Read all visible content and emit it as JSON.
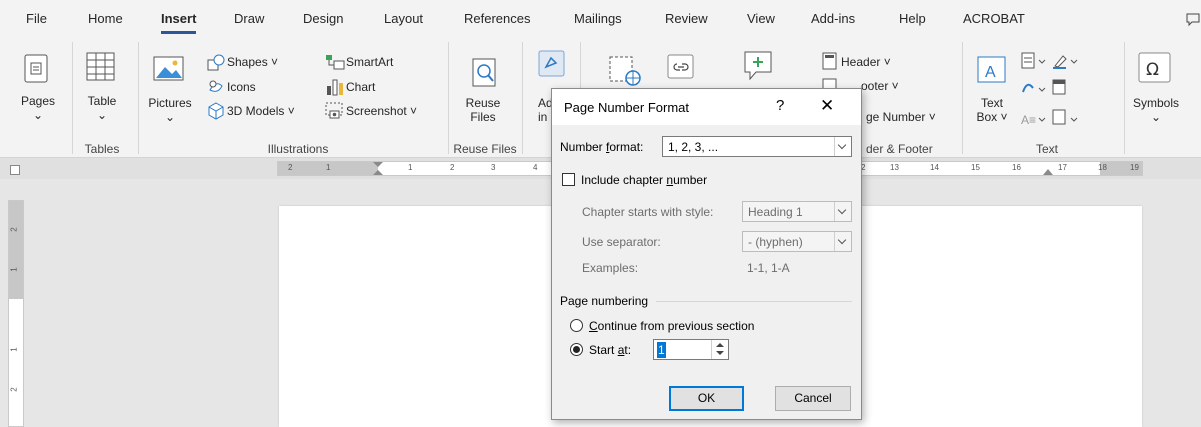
{
  "menu": {
    "tabs": [
      "File",
      "Home",
      "Insert",
      "Draw",
      "Design",
      "Layout",
      "References",
      "Mailings",
      "Review",
      "View",
      "Add-ins",
      "Help",
      "ACROBAT"
    ],
    "active": "Insert"
  },
  "ribbon": {
    "pages": {
      "label": "Pages",
      "arrow": "⌄"
    },
    "table": {
      "label": "Table",
      "arrow": "⌄"
    },
    "pictures": {
      "label": "Pictures",
      "arrow": "⌄"
    },
    "shapes": "Shapes ˅",
    "icons": "Icons",
    "models": "3D Models ˅",
    "smartart": "SmartArt",
    "chart": "Chart",
    "screenshot": "Screenshot ˅",
    "reuse_files": {
      "line1": "Reuse",
      "line2": "Files"
    },
    "addins_partial": {
      "line1": "Ad",
      "line2": "in"
    },
    "header": "Header ˅",
    "footer_partial": "ooter ˅",
    "page_number_partial": "ge Number ˅",
    "text_box": {
      "line1": "Text",
      "line2": "Box ˅"
    },
    "symbols": {
      "label": "Symbols",
      "arrow": "⌄"
    },
    "groups": {
      "tables": "Tables",
      "illustrations": "Illustrations",
      "reuse_files": "Reuse Files",
      "header_footer_partial": "der & Footer",
      "text": "Text"
    }
  },
  "ruler": {
    "left_numbers": [
      "2",
      "1",
      "1",
      "2",
      "3",
      "4"
    ],
    "right_numbers": [
      "2",
      "13",
      "14",
      "15",
      "16",
      "17",
      "18",
      "19"
    ],
    "vertical_numbers": [
      "2",
      "1",
      "1",
      "2"
    ]
  },
  "dialog": {
    "title": "Page Number Format",
    "help": "?",
    "close": "✕",
    "number_format_label_pre": "Number ",
    "number_format_label_u": "f",
    "number_format_label_post": "ormat:",
    "number_format_value": "1, 2, 3, ...",
    "include_chapter_pre": "Include chapter ",
    "include_chapter_u": "n",
    "include_chapter_post": "umber",
    "chapter_style_label": "Chapter starts with style:",
    "chapter_style_value": "Heading 1",
    "separator_label": "Use separator:",
    "separator_value": "-  (hyphen)",
    "examples_label": "Examples:",
    "examples_value": "1-1, 1-A",
    "page_numbering": "Page numbering",
    "continue_u": "C",
    "continue_post": "ontinue from previous section",
    "start_pre": "Start ",
    "start_u": "a",
    "start_post": "t:",
    "start_value": "1",
    "ok": "OK",
    "cancel": "Cancel"
  }
}
